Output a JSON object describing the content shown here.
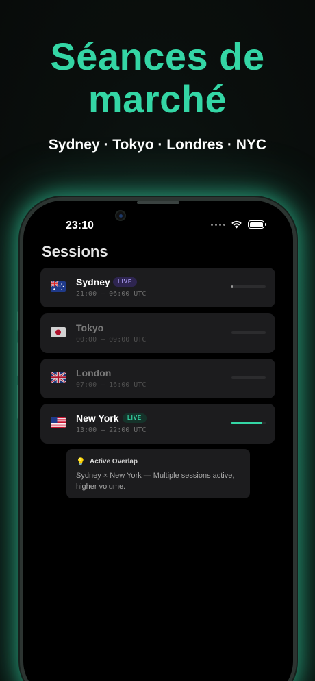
{
  "hero": {
    "headline_line1": "Séances de",
    "headline_line2": "marché",
    "subtitle": "Sydney · Tokyo · Londres · NYC"
  },
  "status_bar": {
    "time": "23:10"
  },
  "screen": {
    "title": "Sessions"
  },
  "sessions": [
    {
      "city": "Sydney",
      "hours": "21:00 — 06:00 UTC",
      "badge": "LIVE",
      "live": true,
      "progress": 0.02,
      "flag": "australia-flag-icon"
    },
    {
      "city": "Tokyo",
      "hours": "00:00 — 09:00 UTC",
      "badge": "",
      "live": false,
      "progress": 0,
      "flag": "japan-flag-icon"
    },
    {
      "city": "London",
      "hours": "07:00 — 16:00 UTC",
      "badge": "",
      "live": false,
      "progress": 0,
      "flag": "uk-flag-icon"
    },
    {
      "city": "New York",
      "hours": "13:00 — 22:00 UTC",
      "badge": "LIVE",
      "live": true,
      "progress": 0.9,
      "flag": "usa-flag-icon"
    }
  ],
  "overlap": {
    "icon": "lightbulb-icon",
    "title": "Active Overlap",
    "body": "Sydney × New York — Multiple sessions active, higher volume."
  },
  "colors": {
    "accent": "#34d6a5",
    "sydney_badge_bg": "#2e2550",
    "sydney_badge_text": "#a89af0",
    "ny_badge_bg": "#15332a",
    "ny_badge_text": "#34d6a5"
  }
}
